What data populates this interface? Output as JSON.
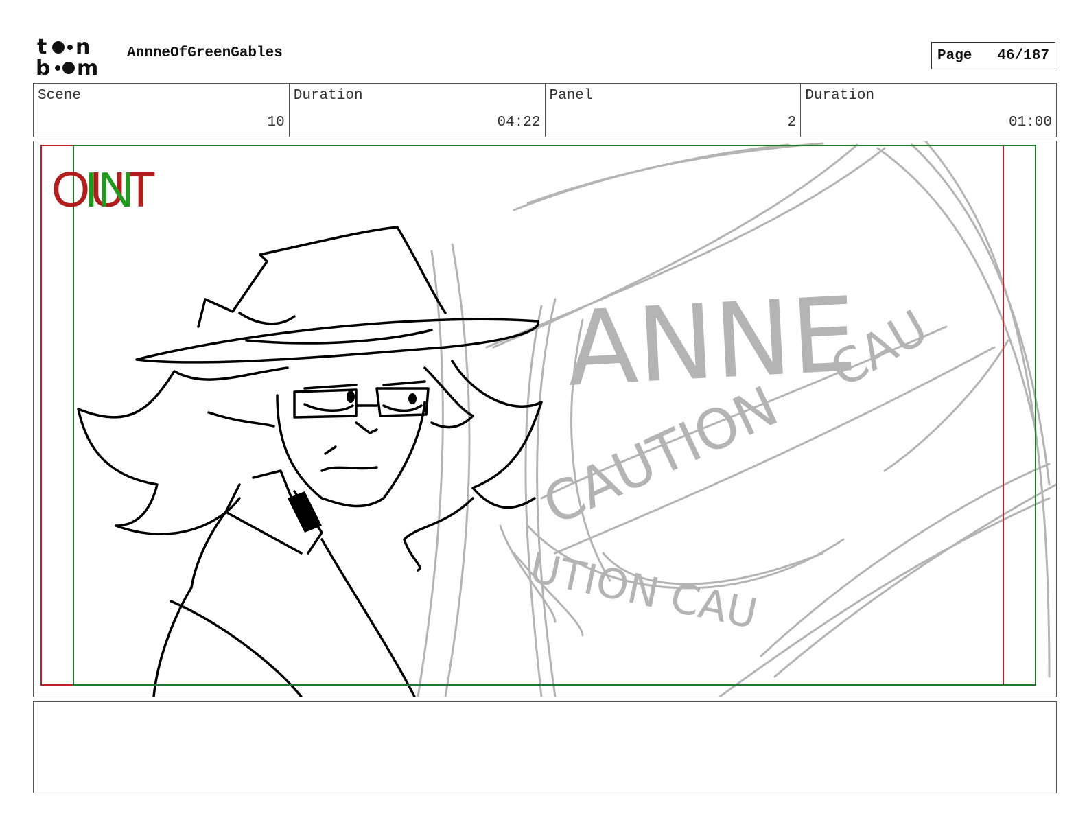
{
  "header": {
    "logo_text": "toonboom",
    "project_title": "AnnneOfGreenGables",
    "page_label": "Page",
    "page_value": "46/187"
  },
  "info": {
    "scene_label": "Scene",
    "scene_value": "10",
    "scene_duration_label": "Duration",
    "scene_duration_value": "04:22",
    "panel_label": "Panel",
    "panel_value": "2",
    "panel_duration_label": "Duration",
    "panel_duration_value": "01:00"
  },
  "panel": {
    "out_marker": "OUT",
    "in_marker": "IN",
    "sketch_text_1": "ANNE",
    "sketch_text_2": "CAUTION",
    "sketch_text_3": "CAU",
    "sketch_text_4": "UTION CAU",
    "out_color": "#b01e1e",
    "in_color": "#1f9a1f",
    "safe_frame_red": "#c0202a",
    "safe_frame_green": "#1f7a2e",
    "sketch_grey": "#b4b4b4",
    "ink": "#000000"
  },
  "notes": {
    "text": ""
  }
}
